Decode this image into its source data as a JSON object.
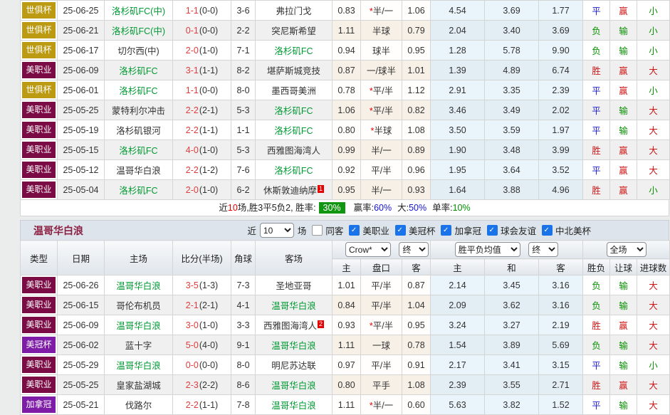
{
  "league_colors": {
    "世俱杯": "#bc9a11",
    "美职业": "#7a0b44",
    "美冠杯": "#7e1ca7",
    "加拿冠": "#7e1ca7"
  },
  "summary": {
    "p1": "近",
    "n1": "10",
    "p2": "场,胜3平5负2, 胜率:",
    "rate_box": "30%",
    "l2": "赢率:",
    "v2": "60%",
    "l3": "大:",
    "v3": "50%",
    "l4": "单率:",
    "v4": "10%"
  },
  "section": {
    "title": "温哥华白浪",
    "near": "近",
    "games": "10",
    "games_unit": "场",
    "filters": [
      {
        "label": "同客",
        "checked": false
      },
      {
        "label": "美职业",
        "checked": true
      },
      {
        "label": "美冠杯",
        "checked": true
      },
      {
        "label": "加拿冠",
        "checked": true
      },
      {
        "label": "球会友谊",
        "checked": true
      },
      {
        "label": "中北美杯",
        "checked": true
      }
    ]
  },
  "table2_header": {
    "cols": [
      "类型",
      "日期",
      "主场",
      "比分(半场)",
      "角球",
      "客场"
    ],
    "selects": {
      "odds": "Crow*",
      "odds_fin": "终",
      "avg": "胜平负均值",
      "avg_fin": "终",
      "scope": "全场"
    },
    "sub": [
      "主",
      "盘口",
      "客",
      "主",
      "和",
      "客",
      "胜负",
      "让球",
      "进球数"
    ]
  },
  "table1": {
    "rows": [
      {
        "lg": "世俱杯",
        "date": "25-06-25",
        "home": "洛杉矶FC(中)",
        "hg": true,
        "hsup": "",
        "ft": "1-1",
        "ht": "(0-0)",
        "cor": "3-6",
        "away": "弗拉门戈",
        "ag": false,
        "asup": "",
        "ah1": "0.83",
        "hand": "*半/一",
        "ah2": "1.06",
        "eu1": "4.54",
        "eux": "3.69",
        "eu2": "1.77",
        "res": "平",
        "let": "赢",
        "goal": "小"
      },
      {
        "lg": "世俱杯",
        "date": "25-06-21",
        "home": "洛杉矶FC(中)",
        "hg": true,
        "hsup": "",
        "ft": "0-1",
        "ht": "(0-0)",
        "cor": "2-2",
        "away": "突尼斯希望",
        "ag": false,
        "asup": "",
        "ah1": "1.11",
        "hand": "半球",
        "ah2": "0.79",
        "eu1": "2.04",
        "eux": "3.40",
        "eu2": "3.69",
        "res": "负",
        "let": "输",
        "goal": "小"
      },
      {
        "lg": "世俱杯",
        "date": "25-06-17",
        "home": "切尔西(中)",
        "hg": false,
        "hsup": "",
        "ft": "2-0",
        "ht": "(1-0)",
        "cor": "7-1",
        "away": "洛杉矶FC",
        "ag": true,
        "asup": "",
        "ah1": "0.94",
        "hand": "球半",
        "ah2": "0.95",
        "eu1": "1.28",
        "eux": "5.78",
        "eu2": "9.90",
        "res": "负",
        "let": "输",
        "goal": "小"
      },
      {
        "lg": "美职业",
        "date": "25-06-09",
        "home": "洛杉矶FC",
        "hg": true,
        "hsup": "",
        "ft": "3-1",
        "ht": "(1-1)",
        "cor": "8-2",
        "away": "堪萨斯城竞技",
        "ag": false,
        "asup": "",
        "ah1": "0.87",
        "hand": "一/球半",
        "ah2": "1.01",
        "eu1": "1.39",
        "eux": "4.89",
        "eu2": "6.74",
        "res": "胜",
        "let": "赢",
        "goal": "大"
      },
      {
        "lg": "世俱杯",
        "date": "25-06-01",
        "home": "洛杉矶FC",
        "hg": true,
        "hsup": "",
        "ft": "1-1",
        "ht": "(0-0)",
        "cor": "8-0",
        "away": "墨西哥美洲",
        "ag": false,
        "asup": "",
        "ah1": "0.78",
        "hand": "*平/半",
        "ah2": "1.12",
        "eu1": "2.91",
        "eux": "3.35",
        "eu2": "2.39",
        "res": "平",
        "let": "赢",
        "goal": "小"
      },
      {
        "lg": "美职业",
        "date": "25-05-25",
        "home": "蒙特利尔冲击",
        "hg": false,
        "hsup": "",
        "ft": "2-2",
        "ht": "(2-1)",
        "cor": "5-3",
        "away": "洛杉矶FC",
        "ag": true,
        "asup": "",
        "ah1": "1.06",
        "hand": "*平/半",
        "ah2": "0.82",
        "eu1": "3.46",
        "eux": "3.49",
        "eu2": "2.02",
        "res": "平",
        "let": "输",
        "goal": "大"
      },
      {
        "lg": "美职业",
        "date": "25-05-19",
        "home": "洛杉矶银河",
        "hg": false,
        "hsup": "",
        "ft": "2-2",
        "ht": "(1-1)",
        "cor": "1-1",
        "away": "洛杉矶FC",
        "ag": true,
        "asup": "",
        "ah1": "0.80",
        "hand": "*半球",
        "ah2": "1.08",
        "eu1": "3.50",
        "eux": "3.59",
        "eu2": "1.97",
        "res": "平",
        "let": "输",
        "goal": "大"
      },
      {
        "lg": "美职业",
        "date": "25-05-15",
        "home": "洛杉矶FC",
        "hg": true,
        "hsup": "",
        "ft": "4-0",
        "ht": "(1-0)",
        "cor": "5-3",
        "away": "西雅图海湾人",
        "ag": false,
        "asup": "",
        "ah1": "0.99",
        "hand": "半/一",
        "ah2": "0.89",
        "eu1": "1.90",
        "eux": "3.48",
        "eu2": "3.99",
        "res": "胜",
        "let": "赢",
        "goal": "大"
      },
      {
        "lg": "美职业",
        "date": "25-05-12",
        "home": "温哥华白浪",
        "hg": false,
        "hsup": "",
        "ft": "2-2",
        "ht": "(1-2)",
        "cor": "7-6",
        "away": "洛杉矶FC",
        "ag": true,
        "asup": "",
        "ah1": "0.92",
        "hand": "平/半",
        "ah2": "0.96",
        "eu1": "1.95",
        "eux": "3.64",
        "eu2": "3.52",
        "res": "平",
        "let": "赢",
        "goal": "大"
      },
      {
        "lg": "美职业",
        "date": "25-05-04",
        "home": "洛杉矶FC",
        "hg": true,
        "hsup": "",
        "ft": "2-0",
        "ht": "(1-0)",
        "cor": "6-2",
        "away": "休斯敦迪纳摩",
        "ag": false,
        "asup": "1",
        "ah1": "0.95",
        "hand": "半/一",
        "ah2": "0.93",
        "eu1": "1.64",
        "eux": "3.88",
        "eu2": "4.96",
        "res": "胜",
        "let": "赢",
        "goal": "小"
      }
    ]
  },
  "table2": {
    "rows": [
      {
        "lg": "美职业",
        "date": "25-06-26",
        "home": "温哥华白浪",
        "hg": true,
        "hsup": "",
        "ft": "3-5",
        "ht": "(1-3)",
        "cor": "7-3",
        "away": "圣地亚哥",
        "ag": false,
        "asup": "",
        "ah1": "1.01",
        "hand": "平/半",
        "ah2": "0.87",
        "eu1": "2.14",
        "eux": "3.45",
        "eu2": "3.16",
        "res": "负",
        "let": "输",
        "goal": "大"
      },
      {
        "lg": "美职业",
        "date": "25-06-15",
        "home": "哥伦布机员",
        "hg": false,
        "hsup": "",
        "ft": "2-1",
        "ht": "(2-1)",
        "cor": "4-1",
        "away": "温哥华白浪",
        "ag": true,
        "asup": "",
        "ah1": "0.84",
        "hand": "平/半",
        "ah2": "1.04",
        "eu1": "2.09",
        "eux": "3.62",
        "eu2": "3.16",
        "res": "负",
        "let": "输",
        "goal": "大"
      },
      {
        "lg": "美职业",
        "date": "25-06-09",
        "home": "温哥华白浪",
        "hg": true,
        "hsup": "",
        "ft": "3-0",
        "ht": "(1-0)",
        "cor": "3-3",
        "away": "西雅图海湾人",
        "ag": false,
        "asup": "2",
        "ah1": "0.93",
        "hand": "*平/半",
        "ah2": "0.95",
        "eu1": "3.24",
        "eux": "3.27",
        "eu2": "2.19",
        "res": "胜",
        "let": "赢",
        "goal": "大"
      },
      {
        "lg": "美冠杯",
        "date": "25-06-02",
        "home": "蓝十字",
        "hg": false,
        "hsup": "",
        "ft": "5-0",
        "ht": "(4-0)",
        "cor": "9-1",
        "away": "温哥华白浪",
        "ag": true,
        "asup": "",
        "ah1": "1.11",
        "hand": "一球",
        "ah2": "0.78",
        "eu1": "1.54",
        "eux": "3.89",
        "eu2": "5.69",
        "res": "负",
        "let": "输",
        "goal": "大"
      },
      {
        "lg": "美职业",
        "date": "25-05-29",
        "home": "温哥华白浪",
        "hg": true,
        "hsup": "",
        "ft": "0-0",
        "ht": "(0-0)",
        "cor": "8-0",
        "away": "明尼苏达联",
        "ag": false,
        "asup": "",
        "ah1": "0.97",
        "hand": "平/半",
        "ah2": "0.91",
        "eu1": "2.17",
        "eux": "3.41",
        "eu2": "3.15",
        "res": "平",
        "let": "输",
        "goal": "小"
      },
      {
        "lg": "美职业",
        "date": "25-05-25",
        "home": "皇家盐湖城",
        "hg": false,
        "hsup": "",
        "ft": "2-3",
        "ht": "(2-2)",
        "cor": "8-6",
        "away": "温哥华白浪",
        "ag": true,
        "asup": "",
        "ah1": "0.80",
        "hand": "平手",
        "ah2": "1.08",
        "eu1": "2.39",
        "eux": "3.55",
        "eu2": "2.71",
        "res": "胜",
        "let": "赢",
        "goal": "大"
      },
      {
        "lg": "加拿冠",
        "date": "25-05-21",
        "home": "伐路尔",
        "hg": false,
        "hsup": "",
        "ft": "2-2",
        "ht": "(1-1)",
        "cor": "7-8",
        "away": "温哥华白浪",
        "ag": true,
        "asup": "",
        "ah1": "1.11",
        "hand": "*半/一",
        "ah2": "0.60",
        "eu1": "5.63",
        "eux": "3.82",
        "eu2": "1.52",
        "res": "平",
        "let": "输",
        "goal": "大"
      }
    ]
  }
}
